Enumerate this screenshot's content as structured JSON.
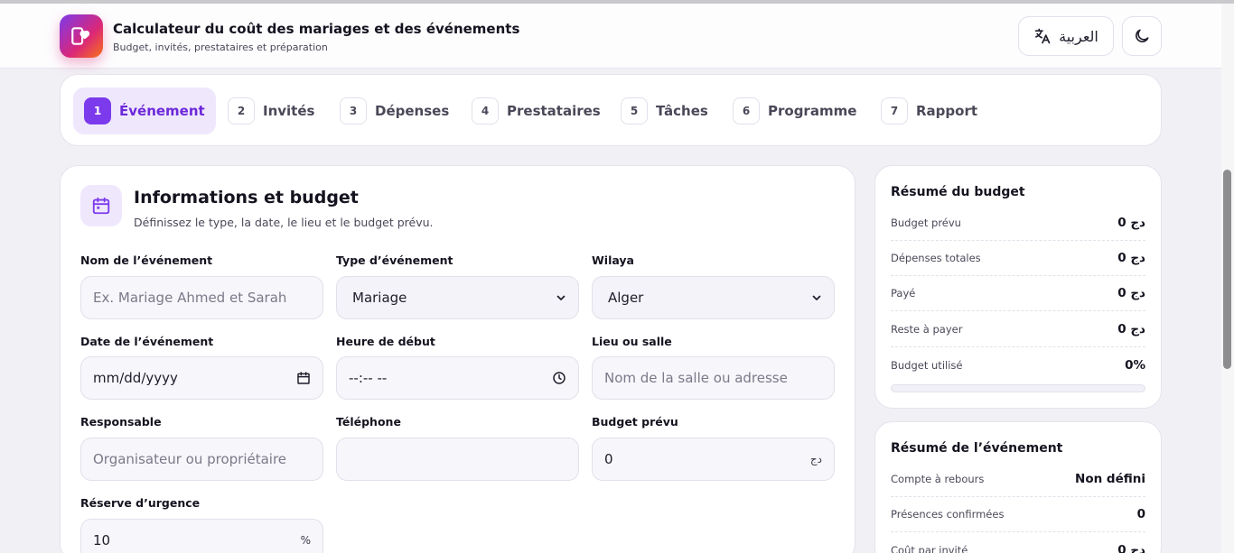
{
  "header": {
    "title": "Calculateur du coût des mariages et des événements",
    "subtitle": "Budget, invités, prestataires et préparation",
    "language_button": "العربية",
    "logo_icon": "heart-phone-icon",
    "language_icon": "translate-icon",
    "theme_icon": "moon-icon"
  },
  "tabs": [
    {
      "num": "1",
      "label": "Événement",
      "active": true
    },
    {
      "num": "2",
      "label": "Invités"
    },
    {
      "num": "3",
      "label": "Dépenses"
    },
    {
      "num": "4",
      "label": "Prestataires"
    },
    {
      "num": "5",
      "label": "Tâches"
    },
    {
      "num": "6",
      "label": "Programme"
    },
    {
      "num": "7",
      "label": "Rapport"
    }
  ],
  "section": {
    "icon": "calendar-icon",
    "title": "Informations et budget",
    "subtitle": "Définissez le type, la date, le lieu et le budget prévu."
  },
  "form": {
    "event_name": {
      "label": "Nom de l’événement",
      "placeholder": "Ex. Mariage Ahmed et Sarah",
      "value": ""
    },
    "event_type": {
      "label": "Type d’événement",
      "value": "Mariage"
    },
    "wilaya": {
      "label": "Wilaya",
      "value": "Alger"
    },
    "event_date": {
      "label": "Date de l’événement",
      "placeholder": "mm/dd/yyyy"
    },
    "start_time": {
      "label": "Heure de début",
      "placeholder": "--:-- --"
    },
    "venue": {
      "label": "Lieu ou salle",
      "placeholder": "Nom de la salle ou adresse"
    },
    "manager": {
      "label": "Responsable",
      "placeholder": "Organisateur ou propriétaire"
    },
    "phone": {
      "label": "Téléphone",
      "value": ""
    },
    "budget": {
      "label": "Budget prévu",
      "value": "0",
      "unit": "دج"
    },
    "reserve": {
      "label": "Réserve d’urgence",
      "value": "10",
      "unit": "%"
    }
  },
  "budget_summary": {
    "title": "Résumé du budget",
    "rows": [
      {
        "label": "Budget prévu",
        "value": "0 دج"
      },
      {
        "label": "Dépenses totales",
        "value": "0 دج"
      },
      {
        "label": "Payé",
        "value": "0 دج"
      },
      {
        "label": "Reste à payer",
        "value": "0 دج"
      },
      {
        "label": "Budget utilisé",
        "value": "0%"
      }
    ],
    "used_fraction": 0,
    "accent_color": "#7c3aed"
  },
  "event_summary": {
    "title": "Résumé de l’événement",
    "rows": [
      {
        "label": "Compte à rebours",
        "value": "Non défini"
      },
      {
        "label": "Présences confirmées",
        "value": "0"
      },
      {
        "label": "Coût par invité",
        "value": "0 دج"
      }
    ]
  }
}
